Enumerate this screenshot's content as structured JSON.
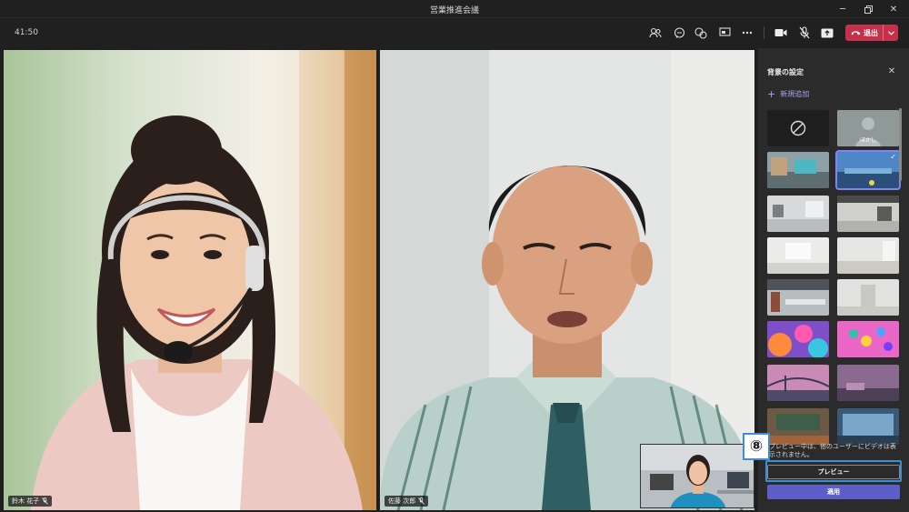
{
  "window": {
    "title": "営業推進会議"
  },
  "toolbar": {
    "timer": "41:50",
    "leave_label": "退出"
  },
  "participants": [
    {
      "name": "鈴木 花子",
      "muted": true
    },
    {
      "name": "佐藤 次郎",
      "muted": true
    }
  ],
  "panel": {
    "title": "背景の設定",
    "add_new": "新規追加",
    "blur_label": "ぼかし",
    "preview_note": "プレビュー中は、他のユーザーにビデオは表示されません。",
    "preview_button": "プレビュー",
    "apply_button": "適用"
  },
  "annotation": {
    "step": "⑧"
  },
  "colors": {
    "accent": "#5b5fc7",
    "leave": "#c4314b",
    "highlight": "#3b8fd4"
  }
}
